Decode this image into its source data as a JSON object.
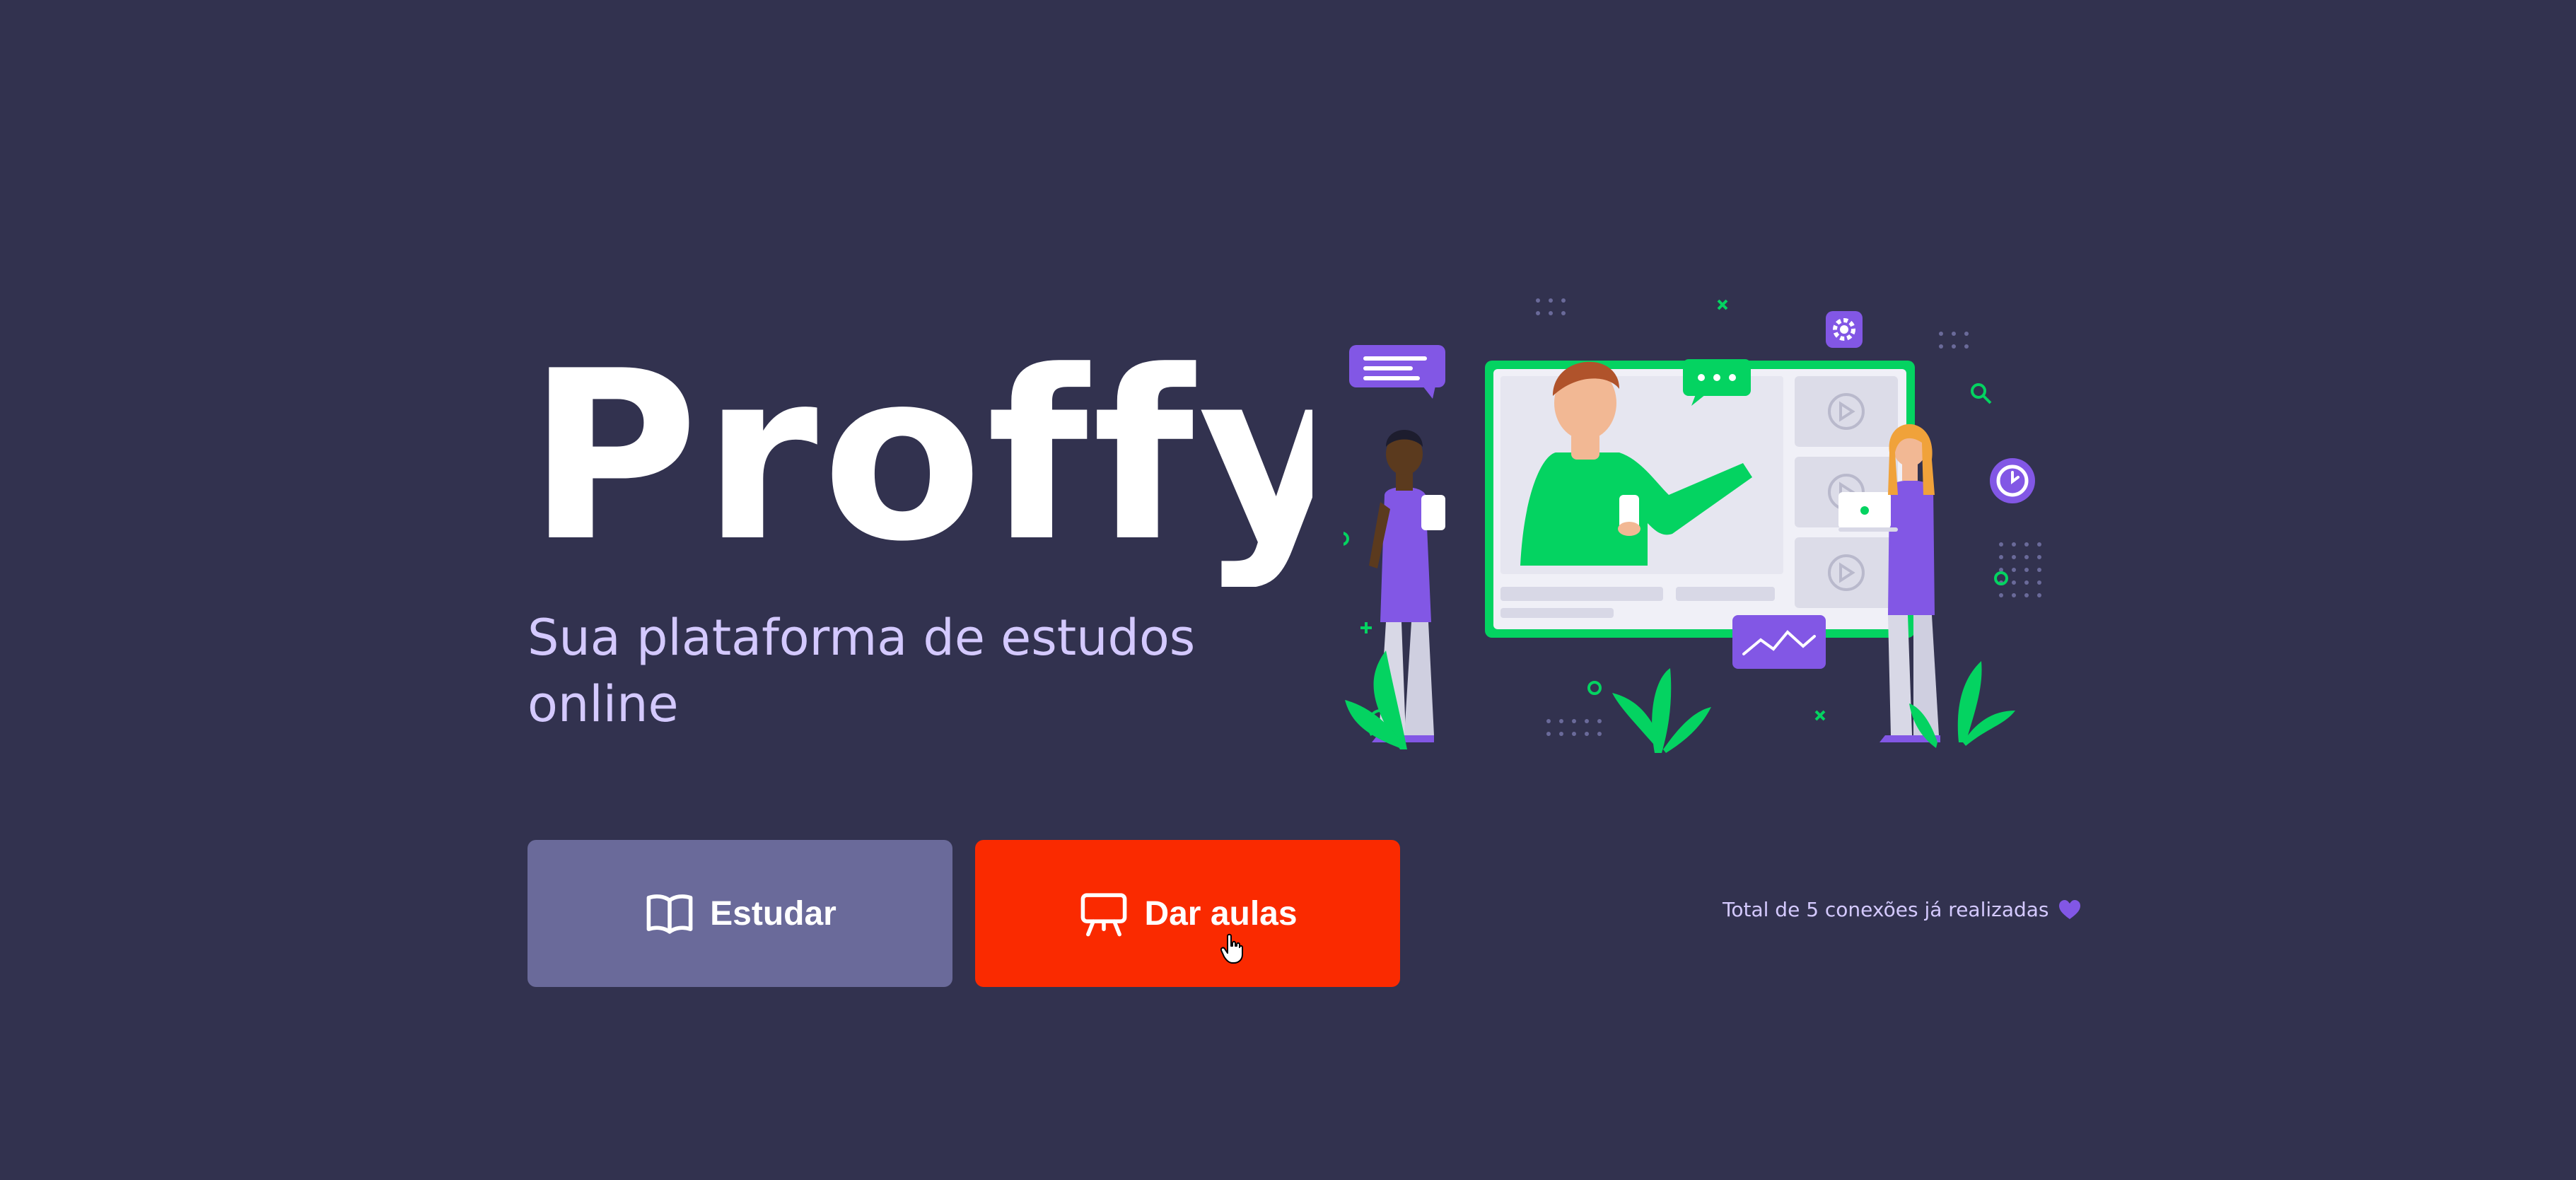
{
  "brand": {
    "logo_text": "Proffy",
    "tagline": "Sua plataforma de estudos online"
  },
  "actions": {
    "study": {
      "label": "Estudar",
      "icon": "open-book-icon",
      "color": "#6a6a9a"
    },
    "teach": {
      "label": "Dar aulas",
      "icon": "presentation-board-icon",
      "color": "#fa2a00"
    }
  },
  "stats": {
    "connections_text": "Total de 5 conexões já realizadas",
    "icon": "purple-heart-icon"
  },
  "theme": {
    "background": "#32324f",
    "accent_purple": "#8257e5",
    "accent_green": "#04d361",
    "tagline_color": "#d4c9ff"
  },
  "illustration": {
    "icons": [
      "chat-bubble-icon",
      "settings-gear-icon",
      "search-icon",
      "clock-icon",
      "play-icon",
      "chart-icon"
    ]
  }
}
